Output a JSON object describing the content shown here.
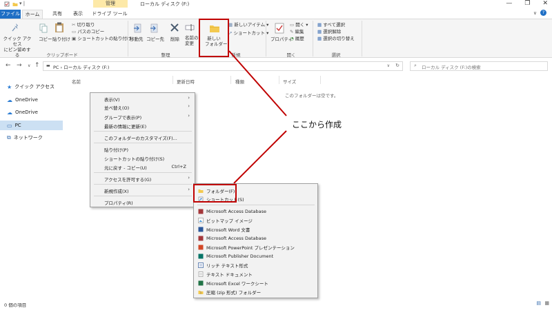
{
  "window": {
    "manage_tab": "管理",
    "title": "ローカル ディスク (F:)",
    "minimize_glyph": "—",
    "maximize_glyph": "❐",
    "close_glyph": "✕"
  },
  "ribbon_tabs": [
    "ファイル",
    "ホーム",
    "共有",
    "表示",
    "ドライブ ツール"
  ],
  "ribbon": {
    "quick_access": "クイック アクセス\nにピン留めする",
    "copy": "コピー",
    "paste": "貼り付け",
    "cut": "切り取り",
    "copy_path": "パスのコピー",
    "paste_shortcut": "ショートカットの貼り付け",
    "clipboard_group": "クリップボード",
    "move_to": "移動先",
    "copy_to": "コピー先",
    "delete": "削除",
    "rename_line1": "名前の",
    "rename_line2": "変更",
    "organize_group": "整理",
    "new_folder_line1": "新しい",
    "new_folder_line2": "フォルダー",
    "new_item": "新しいアイテム ▾",
    "shortcut": "ショートカット ▾",
    "new_group": "新規",
    "properties": "プロパティ",
    "open": "開く ▾",
    "edit": "編集",
    "history": "履歴",
    "open_group": "開く",
    "select_all": "すべて選択",
    "select_none": "選択解除",
    "invert_selection": "選択の切り替え",
    "select_group": "選択"
  },
  "address": {
    "path": "PC  ›  ローカル ディスク (F:)",
    "search_placeholder": "ローカル ディスク (F:)の検索"
  },
  "nav": {
    "items": [
      "クイック アクセス",
      "OneDrive",
      "OneDrive",
      "PC",
      "ネットワーク"
    ]
  },
  "columns": {
    "name": "名前",
    "modified": "更新日時",
    "type": "種類",
    "size": "サイズ",
    "empty_message": "このフォルダーは空です。"
  },
  "context_menu": {
    "items": [
      "表示(V)",
      "並べ替え(O)",
      "グループで表示(P)",
      "最新の情報に更新(E)",
      "このフォルダーのカスタマイズ(F)...",
      "貼り付け(P)",
      "ショートカットの貼り付け(S)",
      "元に戻す - コピー(U)",
      "アクセスを許可する(G)",
      "新規作成(X)",
      "プロパティ(R)"
    ],
    "undo_shortcut": "Ctrl+Z"
  },
  "submenu": {
    "items": [
      "フォルダー(F)",
      "ショートカット(S)",
      "Microsoft Access Database",
      "ビットマップ イメージ",
      "Microsoft Word 文書",
      "Microsoft Access Database",
      "Microsoft PowerPoint プレゼンテーション",
      "Microsoft Publisher Document",
      "リッチ テキスト形式",
      "テキスト ドキュメント",
      "Microsoft Excel ワークシート",
      "圧縮 (zip 形式) フォルダー"
    ]
  },
  "annotation": {
    "callout": "ここから作成",
    "color": "#c00000"
  },
  "status": {
    "item_count": "0 個の項目"
  }
}
